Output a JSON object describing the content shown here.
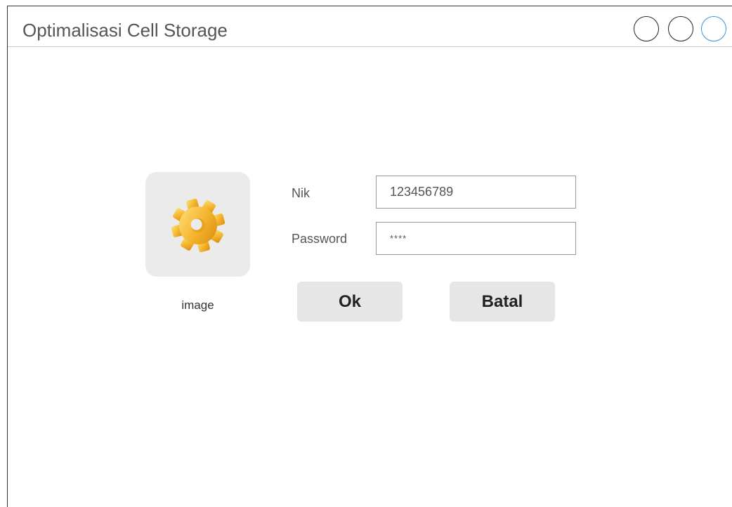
{
  "window": {
    "title": "Optimalisasi Cell Storage"
  },
  "image_tile": {
    "icon": "gear-icon",
    "caption": "image"
  },
  "form": {
    "nik_label": "Nik",
    "nik_value": "123456789",
    "password_label": "Password",
    "password_value": "****"
  },
  "buttons": {
    "ok_label": "Ok",
    "cancel_label": "Batal"
  },
  "colors": {
    "gear": "#f3b32b",
    "tile_background": "#ebebeb",
    "button_background": "#e6e6e6",
    "maximize_button_border": "#3f8fe0"
  }
}
